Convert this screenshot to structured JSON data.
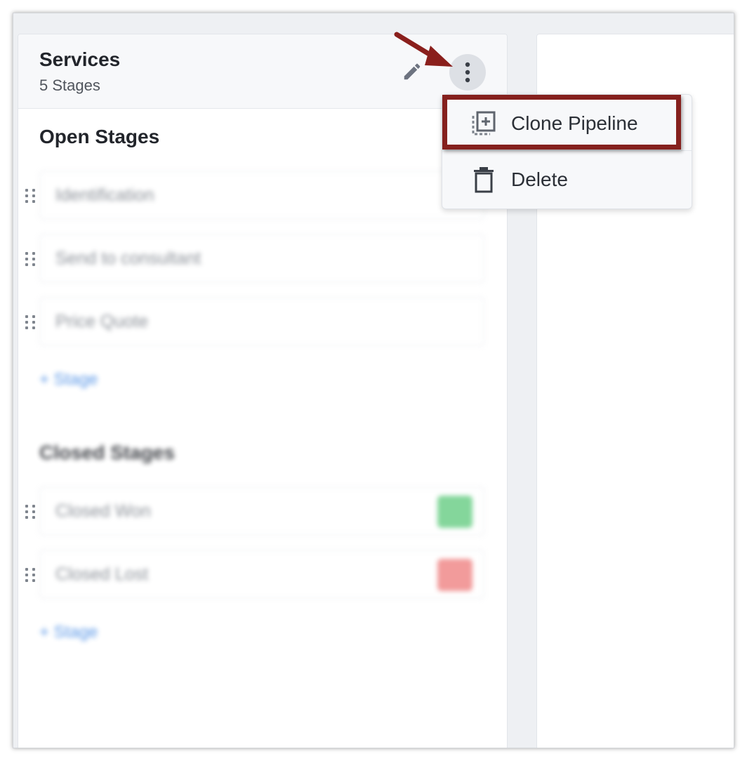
{
  "pipeline": {
    "name": "Services",
    "stage_count": "5 Stages"
  },
  "open_stages": {
    "title": "Open Stages",
    "items": [
      "Identification",
      "Send to consultant",
      "Price Quote"
    ],
    "add_label": "+ Stage"
  },
  "closed_stages": {
    "title": "Closed Stages",
    "items": [
      "Closed Won",
      "Closed Lost"
    ],
    "add_label": "+ Stage"
  },
  "menu": {
    "clone_label": "Clone Pipeline",
    "delete_label": "Delete"
  },
  "colors": {
    "highlight": "#85201d",
    "won": "#6fd08a",
    "lost": "#f08a8a",
    "link": "#3f86e3"
  }
}
